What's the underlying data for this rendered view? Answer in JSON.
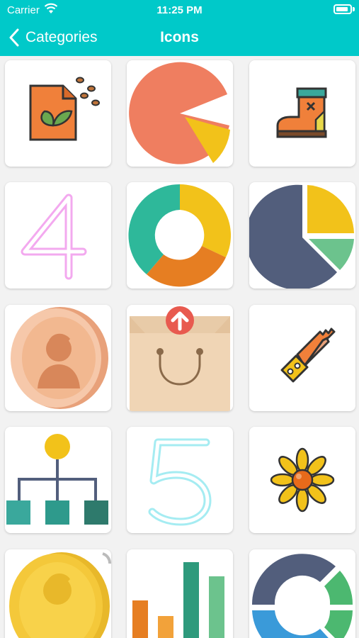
{
  "status": {
    "carrier": "Carrier",
    "time": "11:25 PM"
  },
  "nav": {
    "back_label": "Categories",
    "title": "Icons"
  },
  "icons": [
    "seed-file-icon",
    "pie-chart-icon",
    "boot-icon",
    "neon-four-icon",
    "donut-chart-icon",
    "pie-chart-segments-icon",
    "bronze-coin-icon",
    "shopping-bag-upload-icon",
    "saw-icon",
    "hierarchy-icon",
    "neon-five-icon",
    "sunflower-icon",
    "gold-coin-icon",
    "bar-chart-icon",
    "ring-chart-icon"
  ],
  "colors": {
    "header": "#00c9c9",
    "background": "#f2f2f2"
  }
}
